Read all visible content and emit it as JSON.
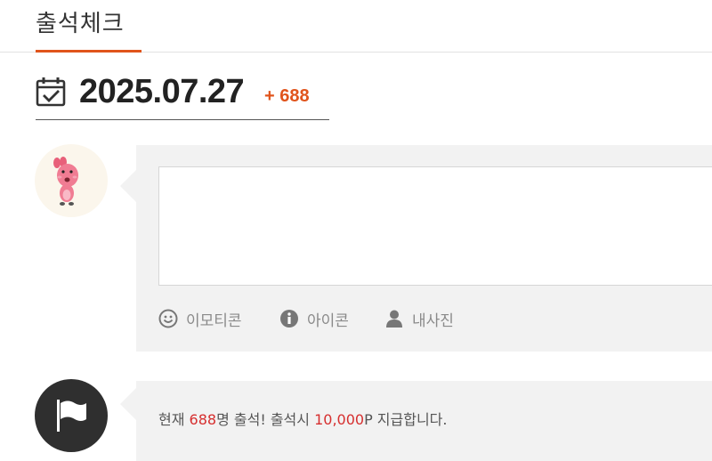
{
  "header": {
    "title": "출석체크"
  },
  "date_section": {
    "date": "2025.07.27",
    "count": "+ 688"
  },
  "comment": {
    "textarea_value": "",
    "toolbar": {
      "emoticon_label": "이모티콘",
      "icon_label": "아이콘",
      "photo_label": "내사진"
    }
  },
  "notice": {
    "prefix": "현재 ",
    "count": "688",
    "middle": "명 출석! 출석시 ",
    "points": "10,000",
    "suffix": "P 지급합니다."
  },
  "colors": {
    "accent": "#e0541c",
    "highlight": "#d62f2f",
    "box_bg": "#f2f2f2"
  }
}
